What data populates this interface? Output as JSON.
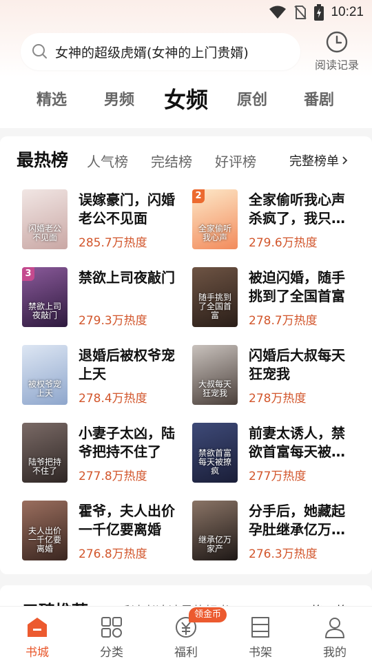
{
  "status_bar": {
    "time": "10:21"
  },
  "search": {
    "text": "女神的超级虎婿(女神的上门贵婿)"
  },
  "history": {
    "label": "阅读记录"
  },
  "channel_tabs": [
    {
      "label": "精选",
      "active": false
    },
    {
      "label": "男频",
      "active": false
    },
    {
      "label": "女频",
      "active": true
    },
    {
      "label": "原创",
      "active": false
    },
    {
      "label": "番剧",
      "active": false
    }
  ],
  "ranking": {
    "title": "最热榜",
    "tabs": [
      "人气榜",
      "完结榜",
      "好评榜"
    ],
    "more_label": "完整榜单",
    "books": [
      {
        "title": "误嫁豪门，闪婚老公不见面",
        "heat": "285.7万热度",
        "cover_text": "闪婚老公不见面",
        "colors": [
          "#f1e6e4",
          "#c9a7a4"
        ],
        "rank": ""
      },
      {
        "title": "全家偷听我心声杀疯了，我只管吃奶",
        "heat": "279.6万热度",
        "cover_text": "全家偷听我心声",
        "colors": [
          "#fde8c8",
          "#f28b5c"
        ],
        "rank": "2"
      },
      {
        "title": "禁欲上司夜敲门",
        "heat": "279.3万热度",
        "cover_text": "禁欲上司夜敲门",
        "colors": [
          "#8a5a9a",
          "#2e1a3e"
        ],
        "rank": "3"
      },
      {
        "title": "被迫闪婚，随手挑到了全国首富",
        "heat": "278.7万热度",
        "cover_text": "随手挑到了全国首富",
        "colors": [
          "#6e5444",
          "#2a1e18"
        ],
        "rank": ""
      },
      {
        "title": "退婚后被权爷宠上天",
        "heat": "278.4万热度",
        "cover_text": "被权爷宠上天",
        "colors": [
          "#dde6f3",
          "#8ea6cc"
        ],
        "rank": ""
      },
      {
        "title": "闪婚后大叔每天狂宠我",
        "heat": "278万热度",
        "cover_text": "大叔每天狂宠我",
        "colors": [
          "#c9c2bd",
          "#4a3f3a"
        ],
        "rank": ""
      },
      {
        "title": "小妻子太凶，陆爷把持不住了",
        "heat": "277.8万热度",
        "cover_text": "陆爷把持不住了",
        "colors": [
          "#7a6a66",
          "#2e2624"
        ],
        "rank": ""
      },
      {
        "title": "前妻太诱人，禁欲首富每天被撩疯",
        "heat": "277万热度",
        "cover_text": "禁欲首富每天被撩疯",
        "colors": [
          "#3e4a78",
          "#1a1e38"
        ],
        "rank": ""
      },
      {
        "title": "霍爷，夫人出价一千亿要离婚",
        "heat": "276.8万热度",
        "cover_text": "夫人出价一千亿要离婚",
        "colors": [
          "#9a6e5e",
          "#3a2620"
        ],
        "rank": ""
      },
      {
        "title": "分手后，她藏起孕肚继承亿万家产",
        "heat": "276.3万热度",
        "cover_text": "继承亿万家产",
        "colors": [
          "#8a7466",
          "#1e1816"
        ],
        "rank": ""
      }
    ]
  },
  "next_section": {
    "title": "口碑推荐",
    "subtitle": "万千读者追读最热好书",
    "switch_label": "换一换"
  },
  "bottom_nav": [
    {
      "label": "书城",
      "icon": "bookstore-icon",
      "active": true
    },
    {
      "label": "分类",
      "icon": "category-icon",
      "active": false
    },
    {
      "label": "福利",
      "icon": "welfare-icon",
      "active": false
    },
    {
      "label": "书架",
      "icon": "bookshelf-icon",
      "active": false
    },
    {
      "label": "我的",
      "icon": "profile-icon",
      "active": false
    }
  ],
  "gold_badge": "领金币",
  "colors": {
    "accent": "#e8562a",
    "heat": "#d2562c"
  }
}
